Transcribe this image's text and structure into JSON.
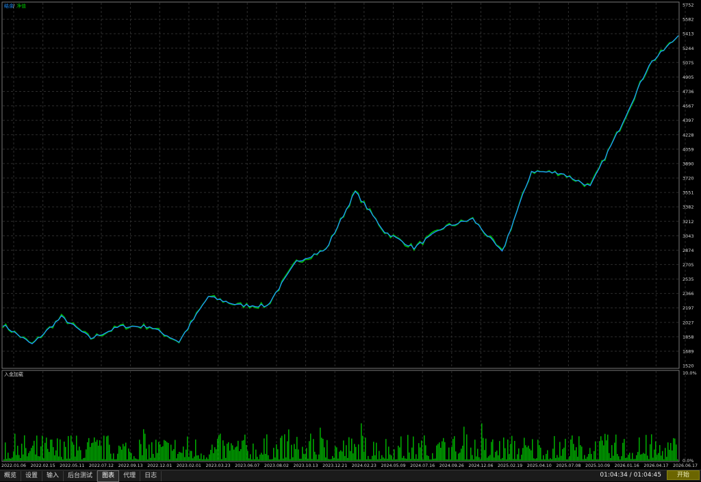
{
  "legend": {
    "equity": "结余",
    "separator": "/",
    "balance": "净值"
  },
  "indicator": {
    "label": "入金加载"
  },
  "y_ticks": [
    "5752",
    "5582",
    "5413",
    "5244",
    "5075",
    "4905",
    "4736",
    "4567",
    "4397",
    "4228",
    "4059",
    "3890",
    "3720",
    "3551",
    "3382",
    "3212",
    "3043",
    "2874",
    "2705",
    "2535",
    "2366",
    "2197",
    "2027",
    "1858",
    "1689",
    "1520"
  ],
  "deposit_ticks": [
    "10.0%",
    "0.0%"
  ],
  "x_ticks": [
    "2022.01.06",
    "2022.02.15",
    "2022.05.11",
    "2022.07.12",
    "2022.09.13",
    "2022.12.01",
    "2023.02.01",
    "2023.03.23",
    "2023.06.07",
    "2023.08.02",
    "2023.10.13",
    "2023.12.21",
    "2024.02.23",
    "2024.05.09",
    "2024.07.16",
    "2024.09.26",
    "2024.12.06",
    "2025.02.19",
    "2025.04.10",
    "2025.07.08",
    "2025.10.09",
    "2026.01.16",
    "2026.04.17",
    "2026.06.17"
  ],
  "colors": {
    "equity": "#1e90ff",
    "balance": "#00c000",
    "background": "#000000",
    "grid": "#2e2e2e",
    "frame": "#7a7a7a"
  },
  "chart_data": {
    "type": "line",
    "series": [
      {
        "name": "结余",
        "color": "#1e90ff"
      },
      {
        "name": "净值",
        "color": "#00c000"
      }
    ],
    "x": [
      "2022.01.06",
      "2022.02.15",
      "2022.05.11",
      "2022.07.12",
      "2022.09.13",
      "2022.12.01",
      "2023.02.01",
      "2023.03.23",
      "2023.06.07",
      "2023.08.02",
      "2023.10.13",
      "2023.12.21",
      "2024.02.23",
      "2024.05.09",
      "2024.07.16",
      "2024.09.26",
      "2024.12.06",
      "2025.02.19",
      "2025.04.10",
      "2025.07.08",
      "2025.10.09",
      "2026.01.16",
      "2026.04.17",
      "2026.06.17"
    ],
    "values": [
      2000,
      1770,
      2090,
      1840,
      1980,
      1980,
      1800,
      2330,
      2230,
      2220,
      2740,
      2880,
      3560,
      3090,
      2900,
      3140,
      3240,
      2850,
      3800,
      3780,
      3620,
      4300,
      5050,
      5390
    ],
    "ylim": [
      1520,
      5752
    ],
    "grid": true,
    "legend": "top-left"
  },
  "tabs": [
    {
      "label": "概览"
    },
    {
      "label": "设置"
    },
    {
      "label": "输入"
    },
    {
      "label": "后台测试"
    },
    {
      "label": "图表"
    },
    {
      "label": "代理"
    },
    {
      "label": "日志"
    }
  ],
  "status": {
    "timer": "01:04:34 / 01:04:45",
    "start_label": "开始"
  }
}
